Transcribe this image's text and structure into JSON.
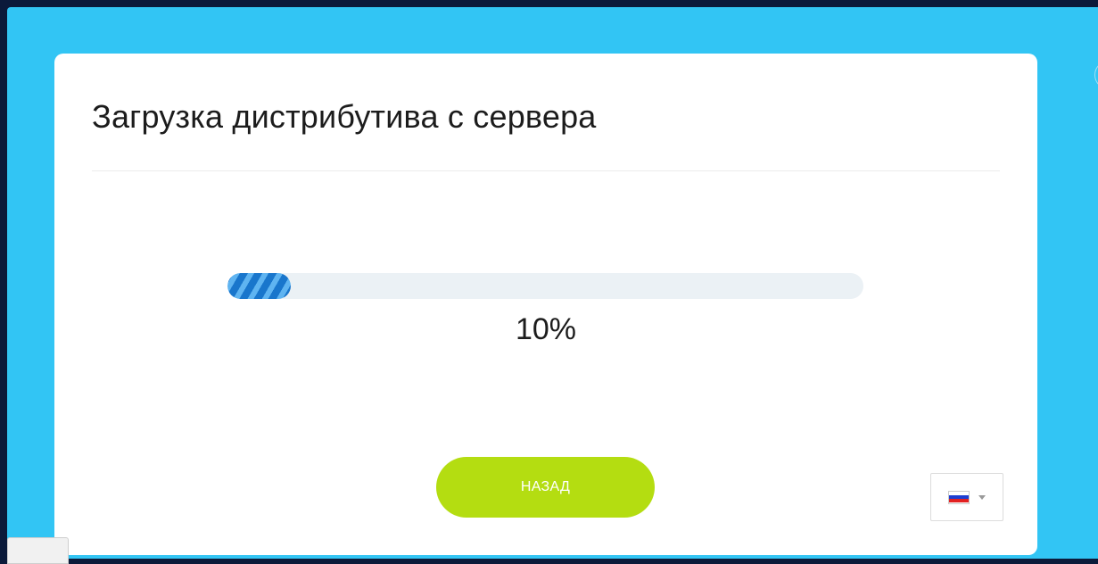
{
  "card": {
    "title": "Загрузка дистрибутива с сервера"
  },
  "progress": {
    "value": 0.1,
    "label": "10%"
  },
  "actions": {
    "back_label": "НАЗАД"
  },
  "language": {
    "selected": "ru",
    "flag_colors": [
      "#ffffff",
      "#1d3fd1",
      "#e22121"
    ]
  },
  "colors": {
    "background": "#32c5f4",
    "accent_button": "#b4dd11",
    "progress_fill": "#1d83d6",
    "progress_track": "#ebf1f5"
  }
}
